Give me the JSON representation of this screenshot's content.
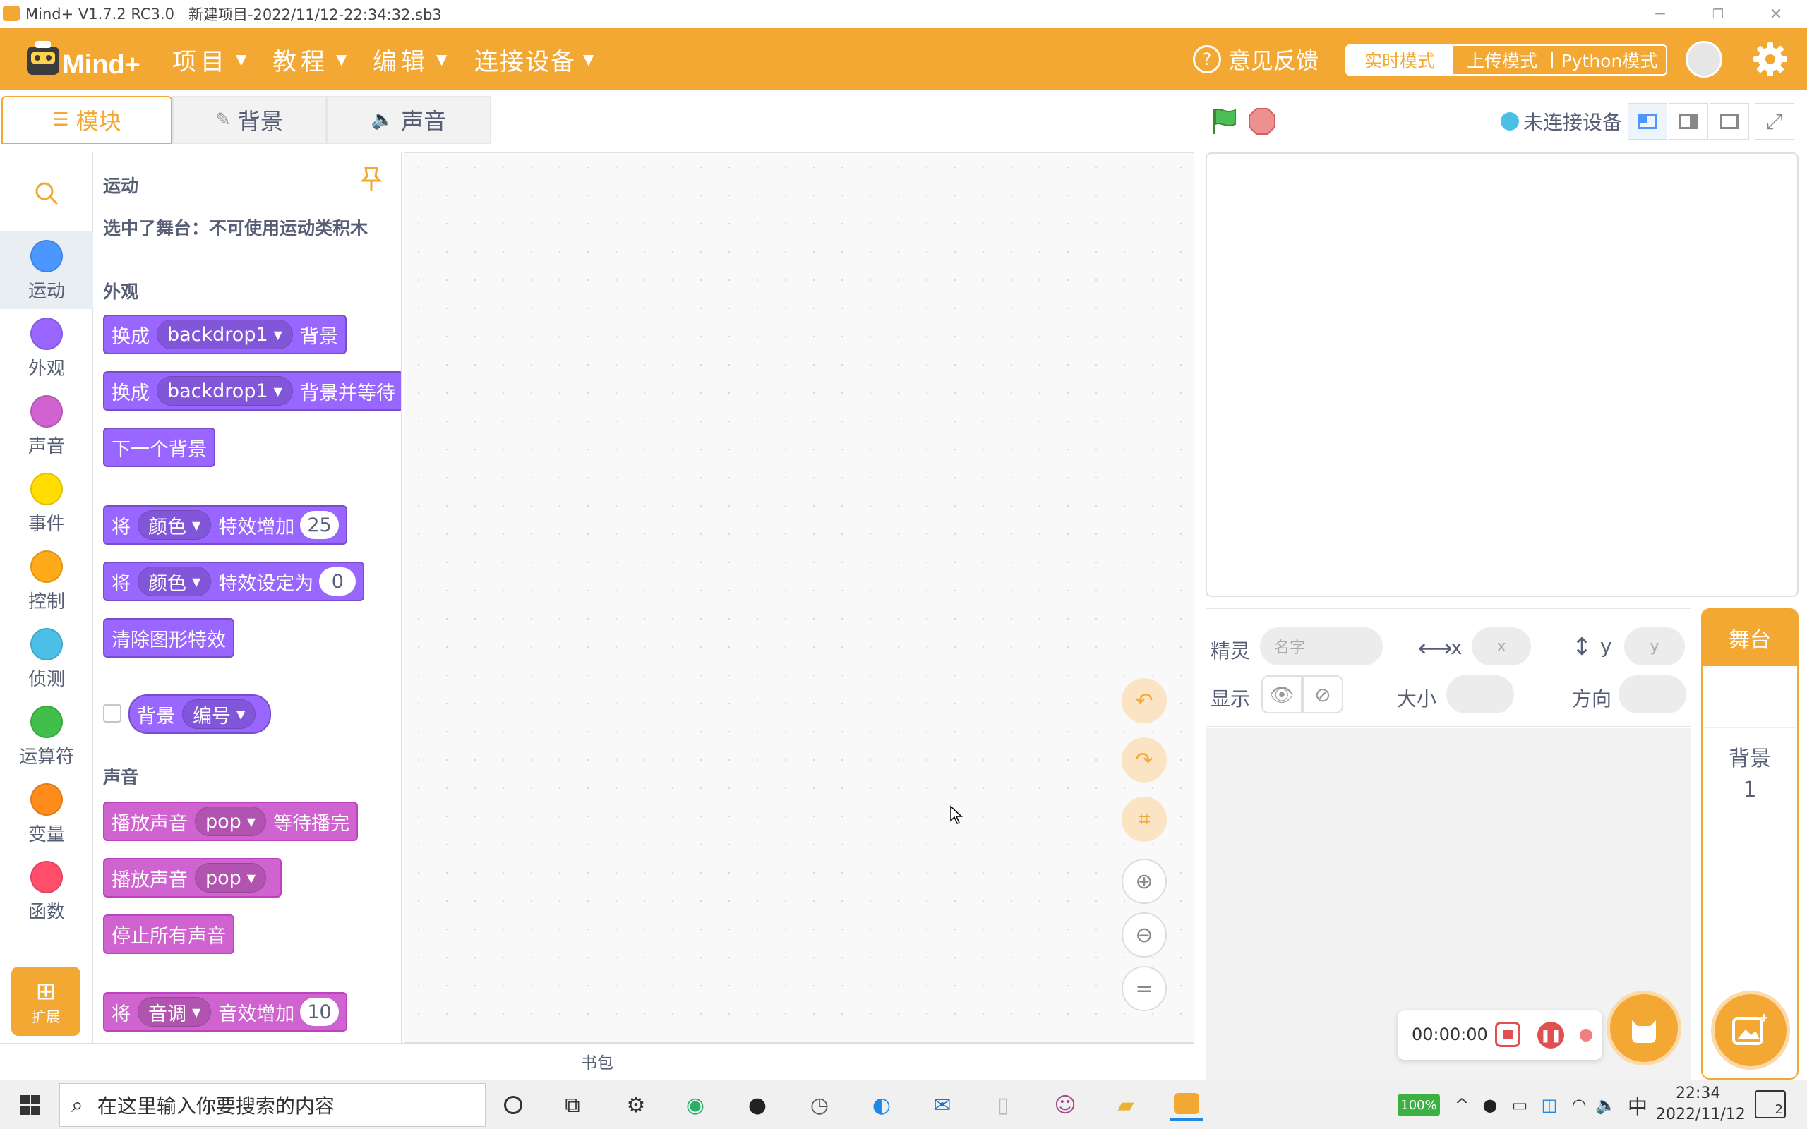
{
  "window": {
    "app_title": "Mind+ V1.7.2 RC3.0",
    "project_title": "新建项目-2022/11/12-22:34:32.sb3"
  },
  "menubar": {
    "logo_text": "Mind+",
    "items": [
      {
        "label": "项目"
      },
      {
        "label": "教程"
      },
      {
        "label": "编辑"
      },
      {
        "label": "连接设备"
      }
    ],
    "feedback_label": "意见反馈",
    "modes": [
      {
        "label": "实时模式",
        "active": true
      },
      {
        "label": "上传模式",
        "active": false
      },
      {
        "label": "Python模式",
        "active": false
      }
    ]
  },
  "tabs": [
    {
      "label": "模块",
      "active": true
    },
    {
      "label": "背景",
      "active": false
    },
    {
      "label": "声音",
      "active": false
    }
  ],
  "stage_header": {
    "device_status": "未连接设备"
  },
  "categories": [
    {
      "label": "运动",
      "color": "#4c97ff",
      "active": true
    },
    {
      "label": "外观",
      "color": "#9966ff"
    },
    {
      "label": "声音",
      "color": "#cf63cf"
    },
    {
      "label": "事件",
      "color": "#ffdd00"
    },
    {
      "label": "控制",
      "color": "#ffab19"
    },
    {
      "label": "侦测",
      "color": "#4cbfe6"
    },
    {
      "label": "运算符",
      "color": "#40bf4a"
    },
    {
      "label": "变量",
      "color": "#ff8c1a"
    },
    {
      "label": "函数",
      "color": "#ff4d6a"
    }
  ],
  "extension_label": "扩展",
  "palette": {
    "motion_title": "运动",
    "motion_note": "选中了舞台：不可使用运动类积木",
    "looks_title": "外观",
    "sound_title": "声音",
    "blocks": {
      "switch_backdrop": {
        "pre": "换成",
        "menu": "backdrop1",
        "post": "背景"
      },
      "switch_backdrop_wait": {
        "pre": "换成",
        "menu": "backdrop1",
        "post": "背景并等待"
      },
      "next_backdrop": {
        "text": "下一个背景"
      },
      "change_effect": {
        "pre": "将",
        "menu": "颜色",
        "mid": "特效增加",
        "value": "25"
      },
      "set_effect": {
        "pre": "将",
        "menu": "颜色",
        "mid": "特效设定为",
        "value": "0"
      },
      "clear_effects": {
        "text": "清除图形特效"
      },
      "backdrop_reporter": {
        "pre": "背景",
        "menu": "编号"
      },
      "play_until_done": {
        "pre": "播放声音",
        "menu": "pop",
        "post": "等待播完"
      },
      "play_sound": {
        "pre": "播放声音",
        "menu": "pop"
      },
      "stop_all_sounds": {
        "text": "停止所有声音"
      },
      "change_sound_effect": {
        "pre": "将",
        "menu": "音调",
        "mid": "音效增加",
        "value": "10"
      }
    }
  },
  "workspace": {
    "backpack_label": "书包"
  },
  "sprite_info": {
    "sprite_label": "精灵",
    "name_placeholder": "名字",
    "x_label": "x",
    "x_placeholder": "x",
    "y_label": "y",
    "y_placeholder": "y",
    "show_label": "显示",
    "size_label": "大小",
    "direction_label": "方向"
  },
  "stage_panel": {
    "title": "舞台",
    "backdrop_label": "背景",
    "backdrop_count": "1"
  },
  "recorder": {
    "time": "00:00:00"
  },
  "taskbar": {
    "search_placeholder": "在这里输入你要搜索的内容",
    "battery": "100%",
    "ime": "中",
    "time": "22:34",
    "date": "2022/11/12",
    "notification_count": "2"
  }
}
